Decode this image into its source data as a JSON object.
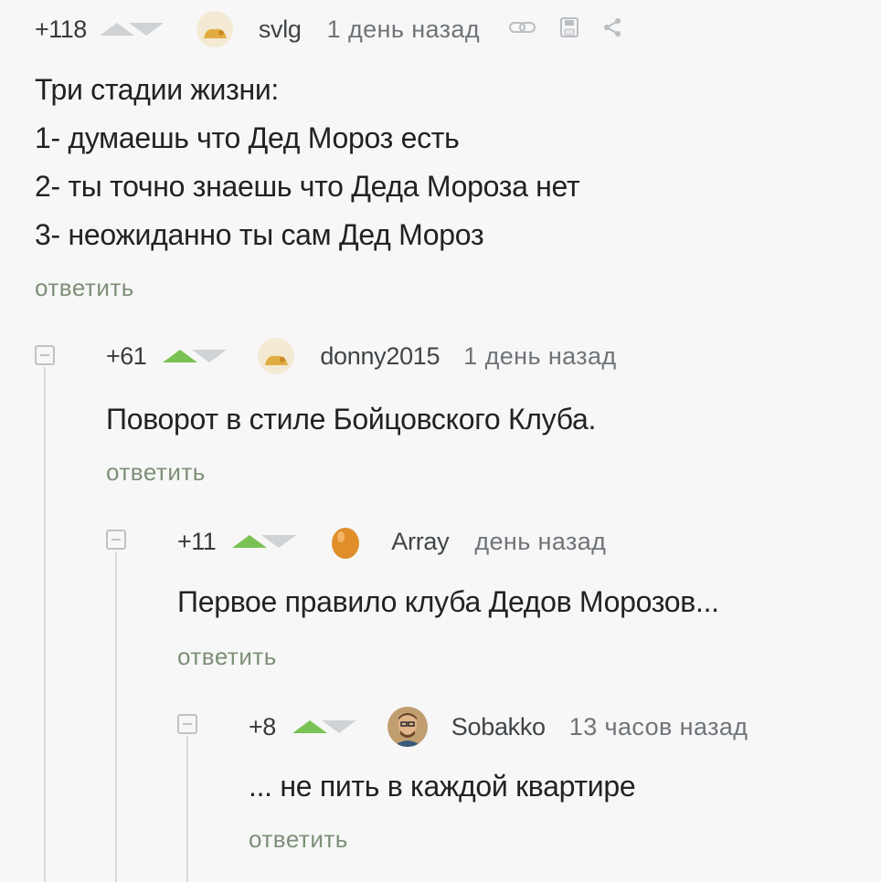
{
  "comments": [
    {
      "rating": "+118",
      "vote_state": "neutral",
      "nick": "svlg",
      "time": "1 день назад",
      "lines": [
        "Три стадии жизни:",
        "1- думаешь что Дед Мороз есть",
        "2- ты точно знаешь что Деда Мороза нет",
        "3- неожиданно ты сам Дед Мороз"
      ],
      "reply_label": "ответить",
      "avatar": "cat-avatar",
      "actions": [
        "link-icon",
        "save-icon",
        "share-icon"
      ]
    },
    {
      "rating": "+61",
      "vote_state": "upvoted",
      "nick": "donny2015",
      "time": "1 день назад",
      "lines": [
        "Поворот в стиле Бойцовского Клуба."
      ],
      "reply_label": "ответить",
      "avatar": "cat-avatar"
    },
    {
      "rating": "+11",
      "vote_state": "upvoted",
      "nick": "Array",
      "time": "день назад",
      "lines": [
        "Первое правило клуба Дедов Морозов..."
      ],
      "reply_label": "ответить",
      "avatar": "egg-avatar"
    },
    {
      "rating": "+8",
      "vote_state": "upvoted",
      "nick": "Sobakko",
      "time": "13 часов назад",
      "lines": [
        "... не пить в каждой квартире"
      ],
      "reply_label": "ответить",
      "avatar": "photo-avatar"
    }
  ],
  "colors": {
    "upvote_active": "#7bc254",
    "vote_inactive": "#cfd3d6",
    "reply_link": "#7d8f78"
  }
}
